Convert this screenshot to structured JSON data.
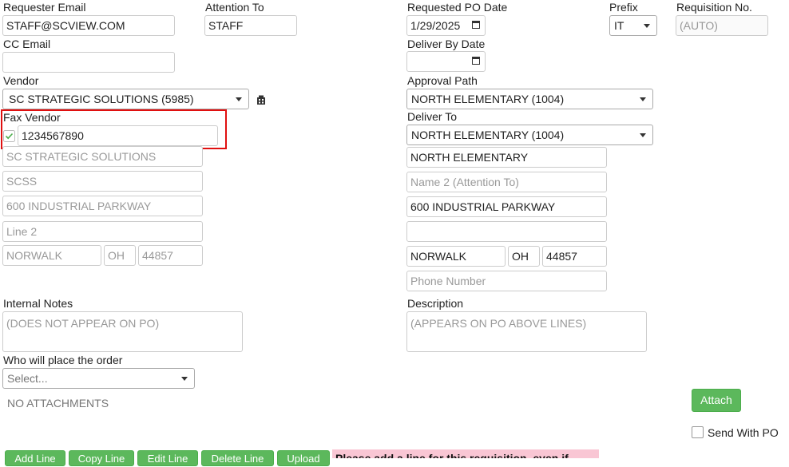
{
  "requester_email": {
    "label": "Requester Email",
    "value": "STAFF@SCVIEW.COM"
  },
  "attention_to": {
    "label": "Attention To",
    "value": "STAFF"
  },
  "requested_po_date": {
    "label": "Requested PO Date",
    "value": "1/29/2025"
  },
  "prefix": {
    "label": "Prefix",
    "value": "IT"
  },
  "requisition_no": {
    "label": "Requisition No.",
    "placeholder": "(AUTO)"
  },
  "cc_email": {
    "label": "CC Email",
    "value": ""
  },
  "deliver_by_date": {
    "label": "Deliver By Date",
    "value": ""
  },
  "vendor": {
    "label": "Vendor",
    "value": "SC STRATEGIC SOLUTIONS (5985)"
  },
  "approval_path": {
    "label": "Approval Path",
    "value": "NORTH ELEMENTARY (1004)"
  },
  "fax_vendor": {
    "label": "Fax Vendor",
    "checked": true,
    "value": "1234567890"
  },
  "deliver_to": {
    "label": "Deliver To",
    "value": "NORTH ELEMENTARY (1004)"
  },
  "vendor_address": {
    "name": "SC STRATEGIC SOLUTIONS",
    "name2": "SCSS",
    "line1": "600 INDUSTRIAL PARKWAY",
    "line2_placeholder": "Line 2",
    "city": "NORWALK",
    "state": "OH",
    "zip": "44857"
  },
  "ship_address": {
    "name": "NORTH ELEMENTARY",
    "name2_placeholder": "Name 2 (Attention To)",
    "line1": "600 INDUSTRIAL PARKWAY",
    "line2": "",
    "city": "NORWALK",
    "state": "OH",
    "zip": "44857",
    "phone_placeholder": "Phone Number"
  },
  "internal_notes": {
    "label": "Internal Notes",
    "placeholder": "(DOES NOT APPEAR ON PO)"
  },
  "description": {
    "label": "Description",
    "placeholder": "(APPEARS ON PO ABOVE LINES)"
  },
  "who_will_place": {
    "label": "Who will place the order",
    "value": "Select..."
  },
  "attachments": {
    "status": "NO ATTACHMENTS",
    "attach_label": "Attach",
    "send_with_po_label": "Send With PO"
  },
  "bottom_bar": {
    "buttons": [
      "Add Line",
      "Copy Line",
      "Edit Line",
      "Delete Line",
      "Upload"
    ],
    "warning": "Please add a line for this requisition, even if..."
  },
  "colors": {
    "accent_green": "#5cb85c",
    "highlight_red": "#e01010",
    "warning_pink": "#f9c6d4"
  }
}
